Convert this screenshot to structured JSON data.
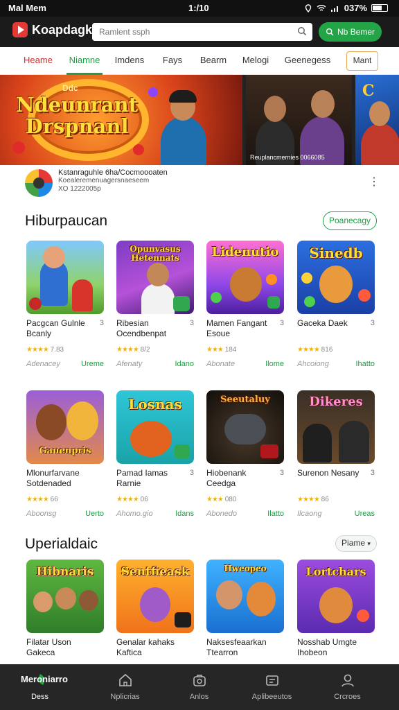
{
  "status": {
    "carrier": "Mal Mem",
    "time": "1:/10",
    "battery": "037%"
  },
  "header": {
    "brand": "Koapdagk",
    "search_placeholder": "Ramlent ssph",
    "signin_label": "Nb Bemer"
  },
  "nav": {
    "tabs": [
      "Heame",
      "Niamne",
      "Imdens",
      "Fays",
      "Bearm",
      "Melogi",
      "Geenegess"
    ],
    "more_label": "Mant"
  },
  "banner": {
    "title_small": "Ddc",
    "title_line1": "Ndeunrant",
    "title_line2": "Drspnanl",
    "side_text": "C",
    "slide2_caption": "Reuplancmernies 0066085"
  },
  "featured": {
    "title": "Kstanraguhle 6ha/Cocmoooaten",
    "subtitle": "Koealeremenuagersnaeseem",
    "meta": "XO 1222005p"
  },
  "sections": [
    {
      "title": "Hiburpaucan",
      "action": "Poanecagy",
      "apps": [
        {
          "name": "Pacgcan Gulnle Bcanly",
          "rank": "3",
          "rating": "7.83",
          "category": "Adenacey",
          "badge": "Ureme",
          "thumb_title": ""
        },
        {
          "name": "Ribesian Ocendbenpat",
          "rank": "3",
          "rating": "8/2",
          "category": "Afenaty",
          "badge": "Idano",
          "thumb_title": "Opunvasus Hetennats"
        },
        {
          "name": "Mamen Fangant Esoue",
          "rank": "3",
          "rating": "184",
          "category": "Abonate",
          "badge": "Ilome",
          "thumb_title": "Lidenutio"
        },
        {
          "name": "Gaceka Daek",
          "rank": "3",
          "rating": "816",
          "category": "Ahcoiong",
          "badge": "Ihatto",
          "thumb_title": "Sinedb"
        }
      ]
    },
    {
      "title": "",
      "action": "",
      "apps": [
        {
          "name": "Mlonurfarvane Sotdenaded",
          "rank": "",
          "rating": "66",
          "category": "Aboonsg",
          "badge": "Uerto",
          "thumb_title": "Gauenpris"
        },
        {
          "name": "Pamad Iamas Rarnie",
          "rank": "3",
          "rating": "06",
          "category": "Ahomo.gio",
          "badge": "Idans",
          "thumb_title": "Losnas"
        },
        {
          "name": "Hiobenank Ceedga",
          "rank": "3",
          "rating": "080",
          "category": "Abonedo",
          "badge": "Ilatto",
          "thumb_title": "Seeutaluy"
        },
        {
          "name": "Surenon Nesany",
          "rank": "3",
          "rating": "86",
          "category": "Ilcaong",
          "badge": "Ureas",
          "thumb_title": "Dikeres"
        }
      ]
    },
    {
      "title": "Uperialdaic",
      "action": "Piame",
      "apps": [
        {
          "name": "Filatar Uson Gakeca",
          "rank": "",
          "rating": "",
          "category": "",
          "badge": "",
          "thumb_title": "Hibnaris"
        },
        {
          "name": "Genalar kahaks Kaftica",
          "rank": "",
          "rating": "",
          "category": "",
          "badge": "",
          "thumb_title": "Sentfieask"
        },
        {
          "name": "Naksesfeaarkan Ttearron",
          "rank": "",
          "rating": "",
          "category": "",
          "badge": "",
          "thumb_title": "Hweopeo"
        },
        {
          "name": "Nosshab Umgte Ihobeon",
          "rank": "",
          "rating": "",
          "category": "",
          "badge": "",
          "thumb_title": "Lortchars"
        }
      ]
    }
  ],
  "bottom_nav": {
    "items": [
      {
        "label": "Dess",
        "icon": "home-leaf-icon"
      },
      {
        "label": "Nplicrias",
        "icon": "house-icon"
      },
      {
        "label": "Anlos",
        "icon": "camera-bag-icon"
      },
      {
        "label": "Aplibeeutos",
        "icon": "apps-box-icon"
      },
      {
        "label": "Crcroes",
        "icon": "person-icon"
      }
    ],
    "brand_short": "Meroniarro"
  },
  "colors": {
    "accent": "#1e9e45",
    "brand": "#e53935",
    "topbar": "#1b1b1b",
    "bottom_bar": "#262626"
  }
}
